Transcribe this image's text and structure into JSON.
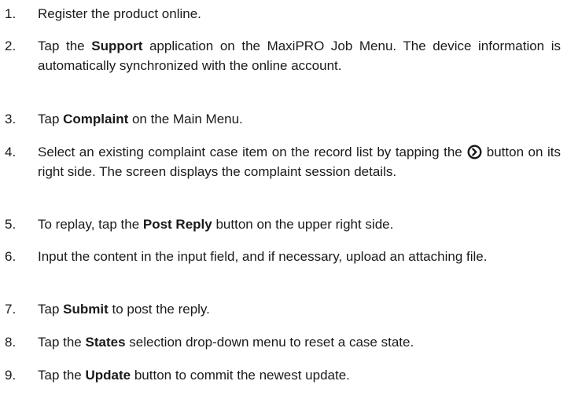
{
  "steps": [
    {
      "num": "1.",
      "parts": [
        "Register the product online."
      ]
    },
    {
      "num": "2.",
      "parts": [
        "Tap the ",
        "Support",
        " application on the MaxiPRO Job Menu. The device information is automatically synchronized with the online account."
      ]
    },
    {
      "num": "3.",
      "parts": [
        "Tap ",
        "Complaint",
        " on the Main Menu."
      ]
    },
    {
      "num": "4.",
      "parts": [
        "Select an existing complaint case item on the record list by tapping the",
        "button on its right side. The screen displays the complaint session details."
      ],
      "icon": "circled-chevron-right-icon"
    },
    {
      "num": "5.",
      "parts": [
        "To replay, tap the ",
        "Post Reply",
        " button on the upper right side."
      ]
    },
    {
      "num": "6.",
      "parts": [
        "Input the content in the input field, and if necessary, upload an attaching file."
      ]
    },
    {
      "num": "7.",
      "parts": [
        "Tap ",
        "Submit",
        " to post the reply."
      ]
    },
    {
      "num": "8.",
      "parts": [
        "Tap the ",
        "States",
        " selection drop-down menu to reset a case state."
      ]
    },
    {
      "num": "9.",
      "parts": [
        "Tap the ",
        "Update",
        " button to commit the newest update."
      ]
    }
  ]
}
